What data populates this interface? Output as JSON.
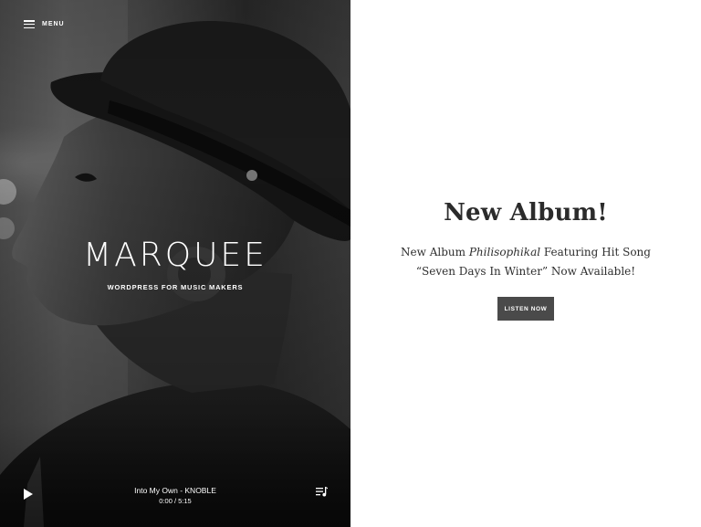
{
  "menu": {
    "label": "MENU",
    "icon": "hamburger-icon"
  },
  "hero": {
    "title": "MARQUEE",
    "tagline": "WORDPRESS FOR MUSIC MAKERS",
    "image": "portrait-photo"
  },
  "player": {
    "track": "Into My Own - KNOBLE",
    "time": "0:00 / 5:15",
    "play_icon": "play-icon",
    "playlist_icon": "playlist-icon"
  },
  "promo": {
    "title": "New Album!",
    "desc_prefix": "New Album ",
    "desc_album": "Philisophikal",
    "desc_suffix": " Featuring Hit Song “Seven Days In Winter” Now Available!",
    "cta_label": "LISTEN NOW"
  },
  "colors": {
    "cta_background": "#4a4a4a",
    "title_text": "#2b2b2b",
    "hero_text": "#ffffff"
  }
}
